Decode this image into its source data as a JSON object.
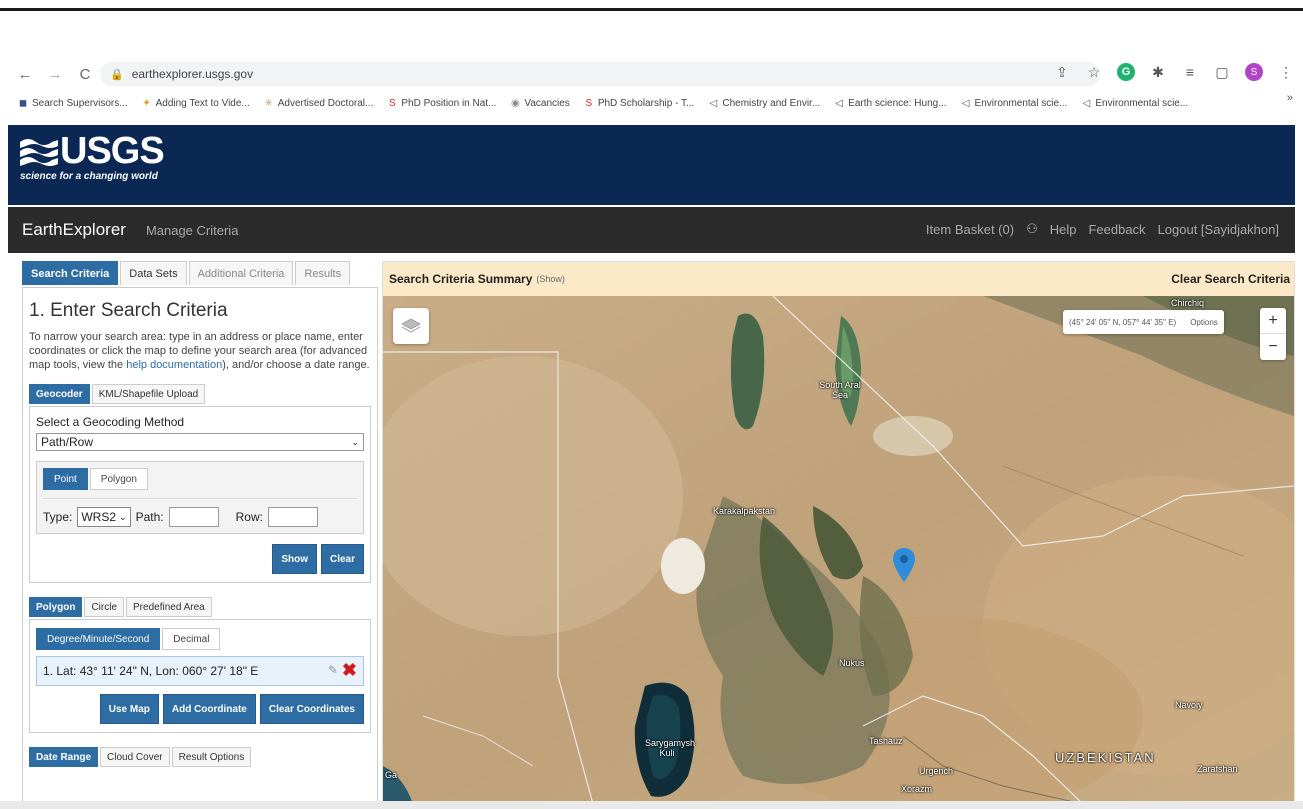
{
  "browser": {
    "url": "earthexplorer.usgs.gov",
    "bookmarks": [
      {
        "icon": "bookmark-shield-icon",
        "glyph": "◼",
        "color": "#3a4f8a",
        "label": "Search Supervisors..."
      },
      {
        "icon": "bookmark-star-icon",
        "glyph": "✦",
        "color": "#e39b15",
        "label": "Adding Text to Vide..."
      },
      {
        "icon": "bookmark-sparkle-icon",
        "glyph": "✳",
        "color": "#c7a26a",
        "label": "Advertised Doctoral..."
      },
      {
        "icon": "bookmark-s-icon",
        "glyph": "S",
        "color": "#d32a2a",
        "label": "PhD Position in Nat..."
      },
      {
        "icon": "bookmark-globe-icon",
        "glyph": "◉",
        "color": "#888888",
        "label": "Vacancies"
      },
      {
        "icon": "bookmark-s-icon",
        "glyph": "S",
        "color": "#d32a2a",
        "label": "PhD Scholarship - T..."
      },
      {
        "icon": "bookmark-send-icon",
        "glyph": "◁",
        "color": "#555555",
        "label": "Chemistry and Envir..."
      },
      {
        "icon": "bookmark-send-icon",
        "glyph": "◁",
        "color": "#555555",
        "label": "Earth science: Hung..."
      },
      {
        "icon": "bookmark-send-icon",
        "glyph": "◁",
        "color": "#555555",
        "label": "Environmental scie..."
      },
      {
        "icon": "bookmark-send-icon",
        "glyph": "◁",
        "color": "#555555",
        "label": "Environmental scie..."
      }
    ],
    "avatar_initial": "S"
  },
  "header": {
    "logo_text": "USGS",
    "tagline": "science for a changing world"
  },
  "nav": {
    "brand": "EarthExplorer",
    "manage": "Manage Criteria",
    "item_basket": "Item Basket (0)",
    "help": "Help",
    "feedback": "Feedback",
    "logout": "Logout [Sayidjakhon]"
  },
  "left": {
    "tabs": [
      "Search Criteria",
      "Data Sets",
      "Additional Criteria",
      "Results"
    ],
    "title": "1. Enter Search Criteria",
    "desc_pre": "To narrow your search area: type in an address or place name, enter coordinates or click the map to define your search area (for advanced map tools, view the ",
    "desc_link": "help documentation",
    "desc_post": "), and/or choose a date range.",
    "geo_tabs": [
      "Geocoder",
      "KML/Shapefile Upload"
    ],
    "geo_label": "Select a Geocoding Method",
    "geo_value": "Path/Row",
    "point_tabs": [
      "Point",
      "Polygon"
    ],
    "type_label": "Type:",
    "type_value": "WRS2",
    "path_label": "Path:",
    "row_label": "Row:",
    "show_btn": "Show",
    "clear_btn": "Clear",
    "shape_tabs": [
      "Polygon",
      "Circle",
      "Predefined Area"
    ],
    "fmt_tabs": [
      "Degree/Minute/Second",
      "Decimal"
    ],
    "coord_entry": "1. Lat: 43° 11' 24\" N, Lon: 060° 27' 18\" E",
    "use_map": "Use Map",
    "add_coord": "Add Coordinate",
    "clear_coords": "Clear Coordinates",
    "bottom_tabs": [
      "Date Range",
      "Cloud Cover",
      "Result Options"
    ]
  },
  "map": {
    "summary_title": "Search Criteria Summary",
    "summary_show": "(Show)",
    "clear_criteria": "Clear Search Criteria",
    "coords": "(45° 24' 05\" N, 057° 44' 35\" E)",
    "options": "Options",
    "zoom_in": "+",
    "zoom_out": "−",
    "labels": {
      "aral": "South Aral Sea",
      "karakalpakstan": "Karakalpakstan",
      "nukus": "Nukus",
      "sarygamysh": "Sarygamysh Kuli",
      "tashauz": "Tashauz",
      "urgench": "Urgench",
      "xorazm": "Xorazm",
      "uzbekistan": "UZBEKISTAN",
      "navoiy": "Navoiy",
      "zarafshan": "Zarafshan",
      "top_right": "Chirchiq",
      "left_edge": "Ga"
    }
  }
}
